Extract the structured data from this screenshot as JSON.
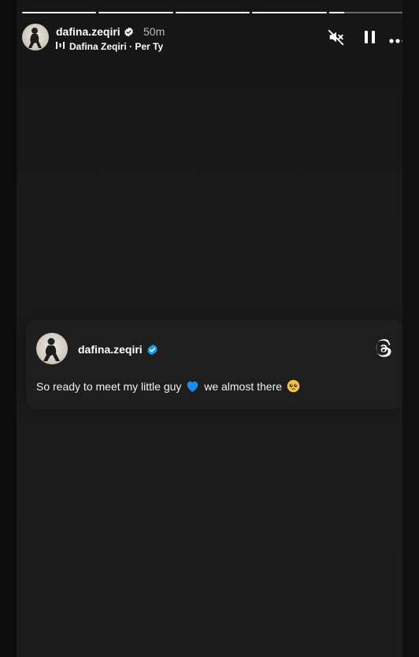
{
  "story": {
    "progress_segments": [
      1,
      1,
      1,
      1,
      0.2
    ],
    "user": {
      "username": "dafina.zeqiri",
      "verified_icon": "verified-badge-icon",
      "time_ago": "50m"
    },
    "music": {
      "icon": "music-bars-icon",
      "text": "Dafina Zeqiri · Per Ty"
    },
    "controls": [
      "muted-speaker-icon",
      "pause-icon",
      "more-options-icon"
    ]
  },
  "card": {
    "username": "dafina.zeqiri",
    "verified_color": "#1d9bf0",
    "platform_icon": "threads-icon",
    "text_before": "So ready to meet my little guy",
    "emoji_1": "💙",
    "text_middle": "we almost there",
    "emoji_2": "🥹"
  },
  "colors": {
    "background": "#0c0c0c",
    "story_bg": "#1a1a1a",
    "card_bg": "#1e1e1e",
    "verified_blue": "#1d9bf0"
  }
}
